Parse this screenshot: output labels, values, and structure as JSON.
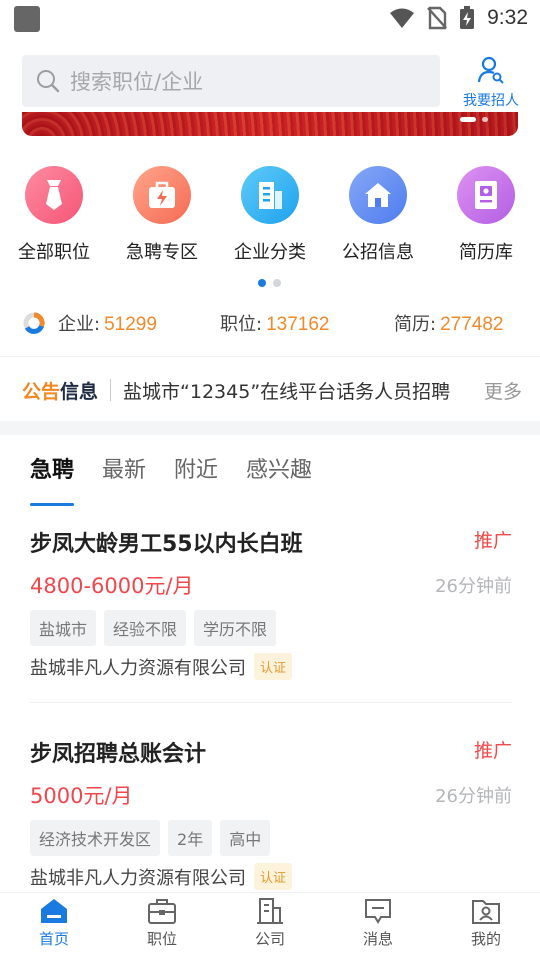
{
  "status_bar": {
    "time": "9:32",
    "icons": [
      "wifi-icon",
      "no-sim-icon",
      "battery-charging-icon"
    ]
  },
  "search": {
    "placeholder": "搜索职位/企业"
  },
  "recruit_button": {
    "label": "我要招人"
  },
  "categories": [
    {
      "label": "全部职位",
      "icon": "tie-icon",
      "color": "#fb6e8a"
    },
    {
      "label": "急聘专区",
      "icon": "urgent-bag-icon",
      "color": "#fc8a6f"
    },
    {
      "label": "企业分类",
      "icon": "building-icon",
      "color": "#35b4f2"
    },
    {
      "label": "公招信息",
      "icon": "home-icon",
      "color": "#5f8df3"
    },
    {
      "label": "简历库",
      "icon": "resume-icon",
      "color": "#c76fe6"
    }
  ],
  "stats": {
    "company": {
      "label": "企业:",
      "value": "51299"
    },
    "jobs": {
      "label": "职位:",
      "value": "137162"
    },
    "resumes": {
      "label": "简历:",
      "value": "277482"
    }
  },
  "notice": {
    "tag_a": "公告",
    "tag_b": "信息",
    "text": "盐城市“12345”在线平台话务人员招聘",
    "more": "更多"
  },
  "tabs": [
    "急聘",
    "最新",
    "附近",
    "感兴趣"
  ],
  "jobs": [
    {
      "title": "步凤大龄男工55以内长白班",
      "promo": "推广",
      "salary": "4800-6000元/月",
      "time": "26分钟前",
      "tags": [
        "盐城市",
        "经验不限",
        "学历不限"
      ],
      "company": "盐城非凡人力资源有限公司",
      "cert": "认证"
    },
    {
      "title": "步凤招聘总账会计",
      "promo": "推广",
      "salary": "5000元/月",
      "time": "26分钟前",
      "tags": [
        "经济技术开发区",
        "2年",
        "高中"
      ],
      "company": "盐城非凡人力资源有限公司",
      "cert": "认证"
    }
  ],
  "bottom_nav": [
    {
      "label": "首页",
      "icon": "home-nav-icon",
      "active": true
    },
    {
      "label": "职位",
      "icon": "briefcase-icon",
      "active": false
    },
    {
      "label": "公司",
      "icon": "company-icon",
      "active": false
    },
    {
      "label": "消息",
      "icon": "message-icon",
      "active": false
    },
    {
      "label": "我的",
      "icon": "profile-folder-icon",
      "active": false
    }
  ],
  "colors": {
    "accent": "#1b7ae0",
    "salary": "#f0464c",
    "stat_number": "#f08a2c",
    "promo": "#f04a4a"
  }
}
